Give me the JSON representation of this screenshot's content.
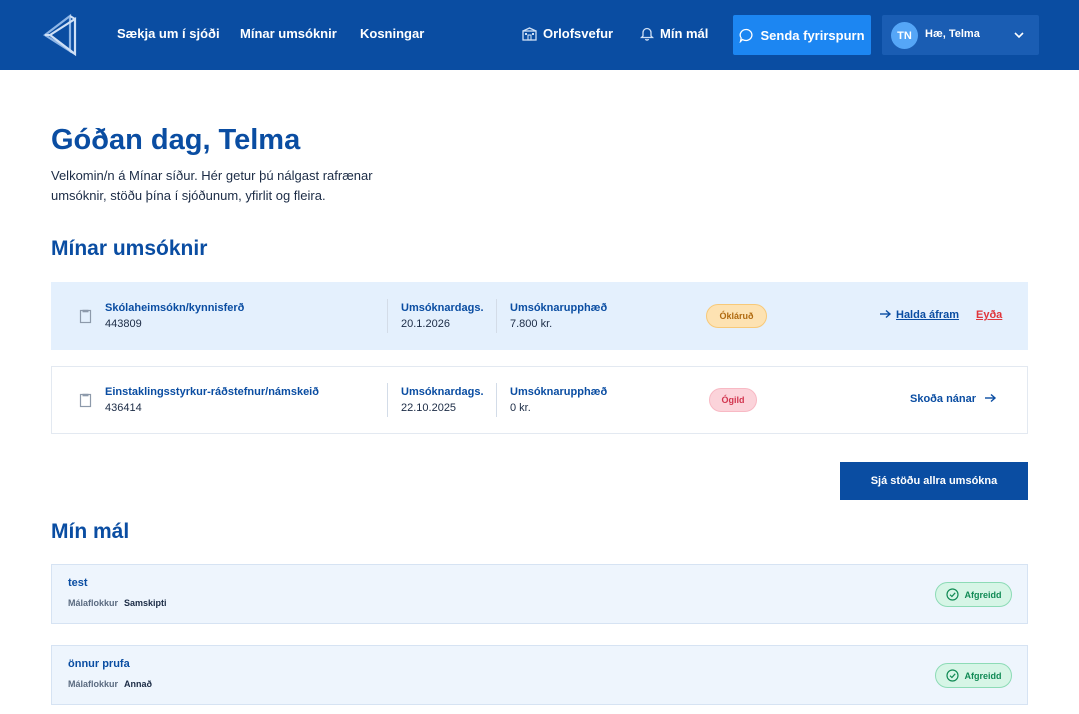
{
  "header": {
    "nav": [
      "Sækja um í sjóði",
      "Mínar umsóknir",
      "Kosningar"
    ],
    "vacation_link": "Orlofsvefur",
    "cases_link": "Mín mál",
    "send_button": "Senda fyrirspurn",
    "user": {
      "initials": "TN",
      "greeting": "Hæ, Telma"
    },
    "colors": {
      "header_bg": "#0a4da2",
      "accent_button": "#1c86f2"
    }
  },
  "intro": {
    "title": "Góðan dag, Telma",
    "text": "Velkomin/n á Mínar síður. Hér getur þú nálgast rafrænar umsóknir, stöðu þína í sjóðunum, yfirlit og fleira."
  },
  "applications": {
    "title": "Mínar umsóknir",
    "date_label": "Umsóknardags.",
    "amount_label": "Umsóknarupphæð",
    "items": [
      {
        "name": "Skólaheimsókn/kynnisferð",
        "id": "443809",
        "date": "20.1.2026",
        "amount": "7.800 kr.",
        "status": "Ókláruð",
        "action": "Halda áfram",
        "delete": "Eyða"
      },
      {
        "name": "Einstaklingsstyrkur-ráðstefnur/námskeið",
        "id": "436414",
        "date": "22.10.2025",
        "amount": "0 kr.",
        "status": "Ógild",
        "action": "Skoða nánar"
      }
    ],
    "all_button": "Sjá stöðu allra umsókna"
  },
  "cases": {
    "title": "Mín mál",
    "category_label": "Málaflokkur",
    "items": [
      {
        "title": "test",
        "category": "Samskipti",
        "status": "Afgreidd"
      },
      {
        "title": "önnur prufa",
        "category": "Annað",
        "status": "Afgreidd"
      }
    ]
  },
  "icons": [
    "logo-icon",
    "building-icon",
    "bell-icon",
    "chat-bubble-icon",
    "chevron-down-icon",
    "document-icon",
    "arrow-right-icon",
    "check-circle-icon"
  ]
}
